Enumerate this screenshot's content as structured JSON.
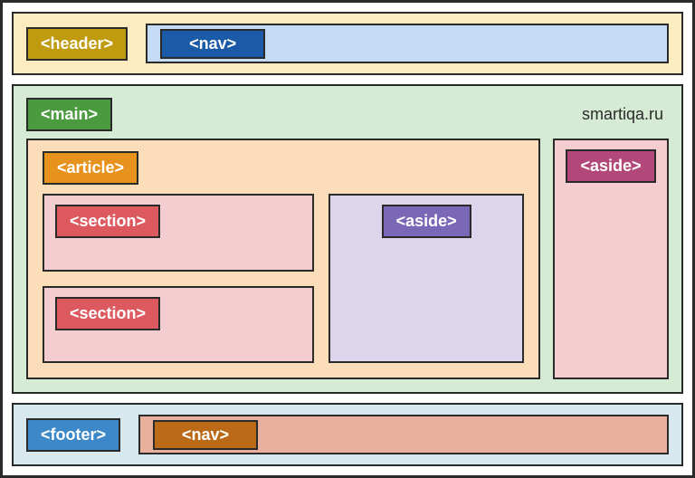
{
  "watermark": "smartiqa.ru",
  "header": {
    "label": "<header>",
    "nav": {
      "label": "<nav>"
    }
  },
  "main": {
    "label": "<main>",
    "article": {
      "label": "<article>",
      "sections": [
        {
          "label": "<section>"
        },
        {
          "label": "<section>"
        }
      ],
      "aside": {
        "label": "<aside>"
      }
    },
    "aside": {
      "label": "<aside>"
    }
  },
  "footer": {
    "label": "<footer>",
    "nav": {
      "label": "<nav>"
    }
  }
}
